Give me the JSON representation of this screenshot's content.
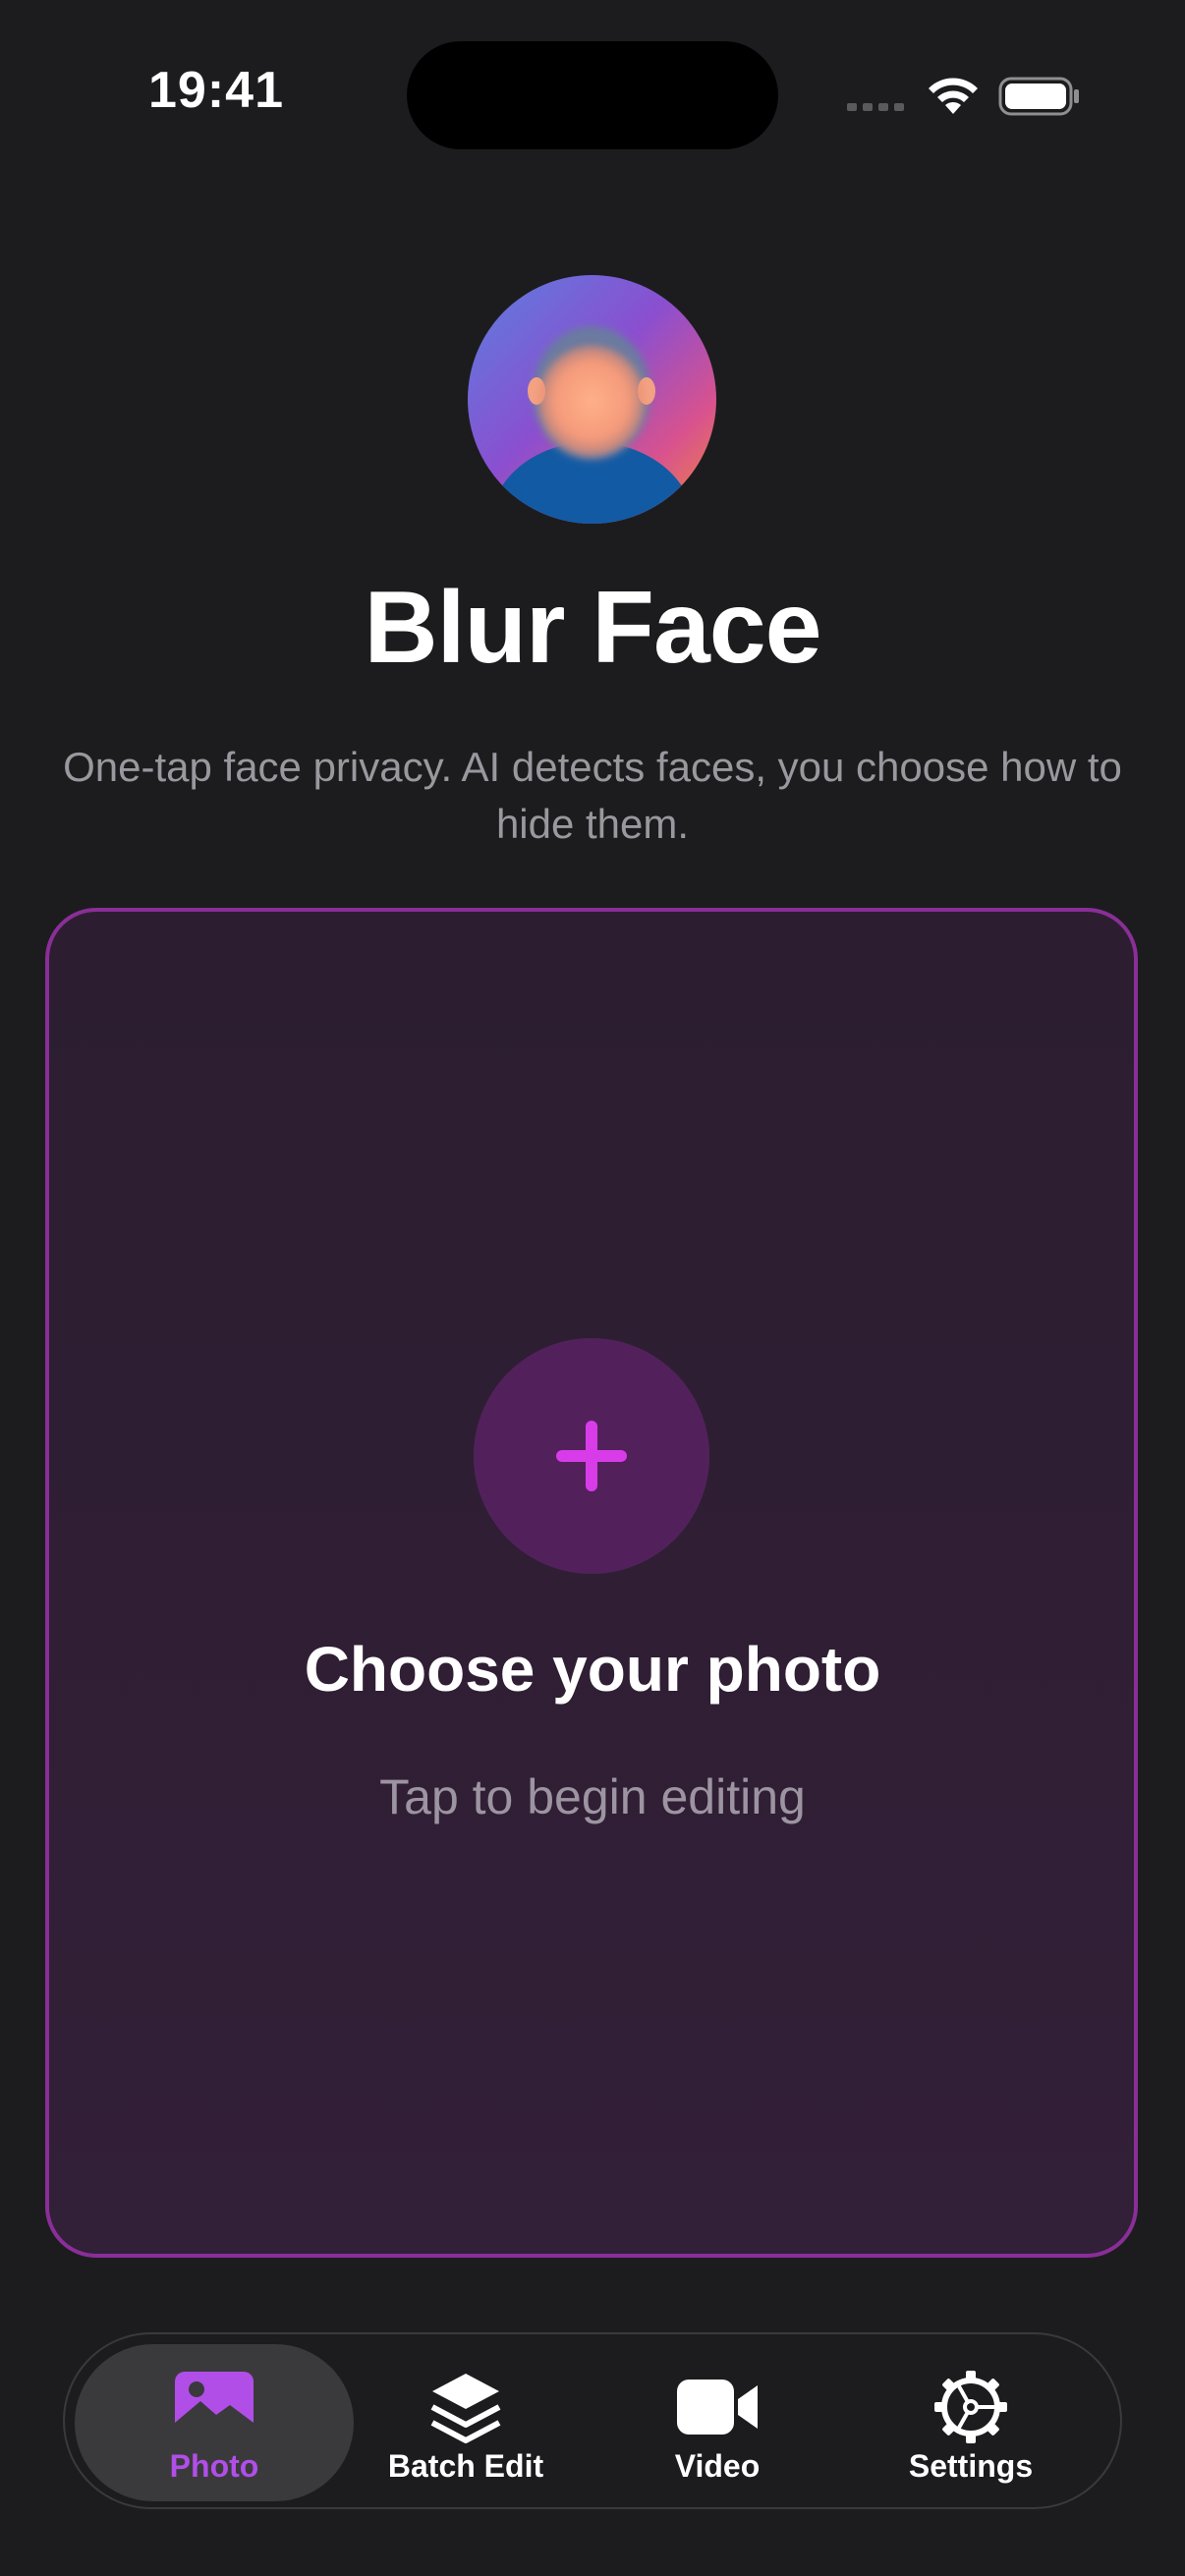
{
  "status_bar": {
    "time": "19:41"
  },
  "header": {
    "title": "Blur Face",
    "subtitle": "One-tap face privacy. AI detects faces, you choose how to hide them."
  },
  "upload_card": {
    "title": "Choose your photo",
    "subtitle": "Tap to begin editing",
    "icon": "plus-icon"
  },
  "tab_bar": {
    "tabs": [
      {
        "label": "Photo",
        "icon": "photo-icon",
        "selected": true
      },
      {
        "label": "Batch Edit",
        "icon": "layers-icon",
        "selected": false
      },
      {
        "label": "Video",
        "icon": "video-camera-icon",
        "selected": false
      },
      {
        "label": "Settings",
        "icon": "gear-icon",
        "selected": false
      }
    ]
  },
  "colors": {
    "background": "#1c1c1e",
    "accent": "#b14ee8",
    "card_border": "#8a2e98",
    "plus": "#d83ce8"
  }
}
